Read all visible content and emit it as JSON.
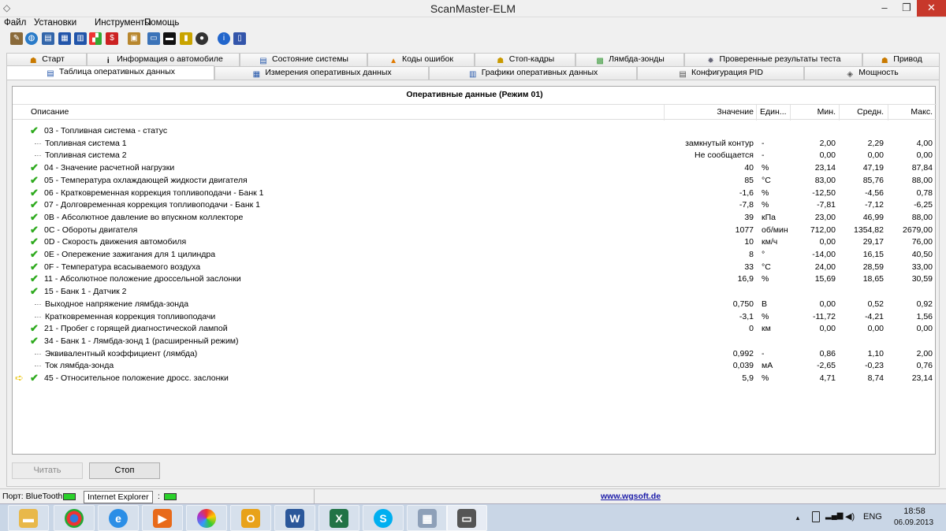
{
  "window": {
    "title": "ScanMaster-ELM",
    "minimize": "–",
    "restore": "❐",
    "close": "✕"
  },
  "menu": [
    "Файл",
    "Установки",
    "Инструменты",
    "Помощь"
  ],
  "toolbar_icons": [
    "wrench-icon",
    "globe-icon",
    "document-icon",
    "table-icon",
    "chart-icon",
    "windows-icon",
    "dollar-icon",
    "clipboard-icon",
    "monitor-icon",
    "terminal-icon",
    "battery-icon",
    "tire-icon",
    "info-icon",
    "book-icon"
  ],
  "tabs_top": [
    "Старт",
    "Информация о автомобиле",
    "Состояние системы",
    "Коды ошибок",
    "Стоп-кадры",
    "Лямбда-зонды",
    "Проверенные результаты теста",
    "Привод"
  ],
  "tabs_bottom": [
    "Таблица оперативных данных",
    "Измерения оперативных данных",
    "Графики оперативных данных",
    "Конфигурация PID",
    "Мощность"
  ],
  "grid": {
    "title": "Оперативные данные (Режим 01)",
    "headers": {
      "desc": "Описание",
      "value": "Значение",
      "unit": "Един...",
      "min": "Мин.",
      "avg": "Средн.",
      "max": "Макс."
    },
    "rows": [
      {
        "type": "check",
        "desc": "03 - Топливная система - статус",
        "value": "",
        "unit": "",
        "min": "",
        "avg": "",
        "max": ""
      },
      {
        "type": "child",
        "desc": "Топливная система 1",
        "value": "замкнутый контур",
        "unit": "-",
        "min": "2,00",
        "avg": "2,29",
        "max": "4,00"
      },
      {
        "type": "child",
        "desc": "Топливная система 2",
        "value": "Не сообщается",
        "unit": "-",
        "min": "0,00",
        "avg": "0,00",
        "max": "0,00"
      },
      {
        "type": "check",
        "desc": "04 - Значение расчетной нагрузки",
        "value": "40",
        "unit": "%",
        "min": "23,14",
        "avg": "47,19",
        "max": "87,84"
      },
      {
        "type": "check",
        "desc": "05 - Температура охлаждающей жидкости двигателя",
        "value": "85",
        "unit": "°C",
        "min": "83,00",
        "avg": "85,76",
        "max": "88,00"
      },
      {
        "type": "check",
        "desc": "06 - Кратковременная коррекция топливоподачи - Банк 1",
        "value": "-1,6",
        "unit": "%",
        "min": "-12,50",
        "avg": "-4,56",
        "max": "0,78"
      },
      {
        "type": "check",
        "desc": "07 - Долговременная коррекция топливоподачи - Банк 1",
        "value": "-7,8",
        "unit": "%",
        "min": "-7,81",
        "avg": "-7,12",
        "max": "-6,25"
      },
      {
        "type": "check",
        "desc": "0B - Абсолютное давление во впускном коллекторе",
        "value": "39",
        "unit": "кПа",
        "min": "23,00",
        "avg": "46,99",
        "max": "88,00"
      },
      {
        "type": "check",
        "desc": "0C - Обороты двигателя",
        "value": "1077",
        "unit": "об/мин",
        "min": "712,00",
        "avg": "1354,82",
        "max": "2679,00"
      },
      {
        "type": "check",
        "desc": "0D - Скорость движения автомобиля",
        "value": "10",
        "unit": "км/ч",
        "min": "0,00",
        "avg": "29,17",
        "max": "76,00"
      },
      {
        "type": "check",
        "desc": "0E - Опережение зажигания для 1 цилиндра",
        "value": "8",
        "unit": "°",
        "min": "-14,00",
        "avg": "16,15",
        "max": "40,50"
      },
      {
        "type": "check",
        "desc": "0F - Температура всасываемого воздуха",
        "value": "33",
        "unit": "°C",
        "min": "24,00",
        "avg": "28,59",
        "max": "33,00"
      },
      {
        "type": "check",
        "desc": "11 - Абсолютное положение дроссельной заслонки",
        "value": "16,9",
        "unit": "%",
        "min": "15,69",
        "avg": "18,65",
        "max": "30,59"
      },
      {
        "type": "check",
        "desc": "15 - Банк 1 - Датчик 2",
        "value": "",
        "unit": "",
        "min": "",
        "avg": "",
        "max": ""
      },
      {
        "type": "child",
        "desc": "Выходное напряжение лямбда-зонда",
        "value": "0,750",
        "unit": "В",
        "min": "0,00",
        "avg": "0,52",
        "max": "0,92"
      },
      {
        "type": "child",
        "desc": "Кратковременная коррекция топливоподачи",
        "value": "-3,1",
        "unit": "%",
        "min": "-11,72",
        "avg": "-4,21",
        "max": "1,56"
      },
      {
        "type": "check",
        "desc": "21 - Пробег с горящей диагностической лампой",
        "value": "0",
        "unit": "км",
        "min": "0,00",
        "avg": "0,00",
        "max": "0,00"
      },
      {
        "type": "check",
        "desc": "34 - Банк 1 - Лямбда-зонд 1 (расширенный режим)",
        "value": "",
        "unit": "",
        "min": "",
        "avg": "",
        "max": ""
      },
      {
        "type": "child",
        "desc": "Эквивалентный коэффициент (лямбда)",
        "value": "0,992",
        "unit": "-",
        "min": "0,86",
        "avg": "1,10",
        "max": "2,00"
      },
      {
        "type": "child",
        "desc": "Ток лямбда-зонда",
        "value": "0,039",
        "unit": "мА",
        "min": "-2,65",
        "avg": "-0,23",
        "max": "0,76"
      },
      {
        "type": "current",
        "desc": "45 - Относительное положение дросс. заслонки",
        "value": "5,9",
        "unit": "%",
        "min": "4,71",
        "avg": "8,74",
        "max": "23,14"
      }
    ]
  },
  "buttons": {
    "read": "Читать",
    "stop": "Стоп"
  },
  "status": {
    "port": "Порт: BlueTooth",
    "tooltip": "Internet Explorer",
    "colon": ":",
    "website": "www.wgsoft.de"
  },
  "taskbar": {
    "apps": [
      "explorer-icon",
      "chrome-icon",
      "ie-icon",
      "media-player-icon",
      "picasa-icon",
      "outlook-icon",
      "word-icon",
      "excel-icon",
      "skype-icon",
      "calculator-icon",
      "scanmaster-icon"
    ],
    "tray": {
      "caret": "▲",
      "lang": "ENG",
      "time": "18:58",
      "date": "06.09.2013"
    }
  }
}
